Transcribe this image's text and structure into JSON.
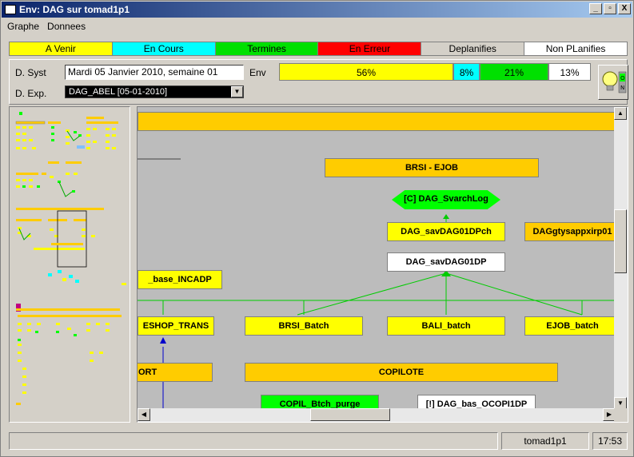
{
  "window": {
    "title": "Env: DAG sur tomad1p1",
    "minimize": "_",
    "maximize": " ",
    "close": "X"
  },
  "menu": [
    "Graphe",
    "Donnees"
  ],
  "legend": [
    {
      "label": "A Venir",
      "color": "#ffff00",
      "text_color": "#000000"
    },
    {
      "label": "En Cours",
      "color": "#00ffff",
      "text_color": "#000000"
    },
    {
      "label": "Termines",
      "color": "#00e000",
      "text_color": "#000000"
    },
    {
      "label": "En Erreur",
      "color": "#ff0000",
      "text_color": "#000000"
    },
    {
      "label": "Deplanifies",
      "color": "#d4d0c8",
      "text_color": "#000000"
    },
    {
      "label": "Non PLanifies",
      "color": "#ffffff",
      "text_color": "#000000"
    }
  ],
  "info": {
    "d_syst_label": "D. Syst",
    "d_syst_value": "Mardi 05 Janvier 2010, semaine 01",
    "env_label": "Env",
    "d_exp_label": "D. Exp.",
    "d_exp_value": "DAG_ABEL      [05-01-2010]"
  },
  "progress": [
    {
      "label": "56%",
      "value": 56,
      "color": "#ffff00"
    },
    {
      "label": "8%",
      "value": 8,
      "color": "#00ffff"
    },
    {
      "label": "21%",
      "value": 21,
      "color": "#00e000"
    },
    {
      "label": "13%",
      "value": 13,
      "color": "#ffffff"
    }
  ],
  "bulb_icon": "lightbulb-on-icon",
  "graph": {
    "nodes": [
      {
        "label": "BRSI - EJOB",
        "state": "deplanifie"
      },
      {
        "label": "[C] DAG_SvarchLog",
        "state": "termine"
      },
      {
        "label": "DAG_savDAG01DPch",
        "state": "a-venir"
      },
      {
        "label": "DAGgtysappxirp01",
        "state": "deplanifie"
      },
      {
        "label": "DAG_savDAG01DP",
        "state": "non-planifie"
      },
      {
        "label": "_base_INCADP",
        "state": "a-venir"
      },
      {
        "label": "ESHOP_TRANS",
        "state": "a-venir"
      },
      {
        "label": "BRSI_Batch",
        "state": "a-venir"
      },
      {
        "label": "BALI_batch",
        "state": "a-venir"
      },
      {
        "label": "EJOB_batch",
        "state": "a-venir"
      },
      {
        "label": "ORT",
        "state": "deplanifie"
      },
      {
        "label": "COPILOTE",
        "state": "deplanifie"
      },
      {
        "label": "COPIL_Btch_purge",
        "state": "termine"
      },
      {
        "label": "[!] DAG_bas_OCOPI1DP",
        "state": "non-planifie"
      }
    ],
    "state_colors": {
      "a-venir": "#ffff00",
      "termine": "#00ff00",
      "non-planifie": "#ffffff",
      "deplanifie": "#ffcc00"
    }
  },
  "status": {
    "message": "",
    "host": "tomad1p1",
    "time": "17:53"
  }
}
